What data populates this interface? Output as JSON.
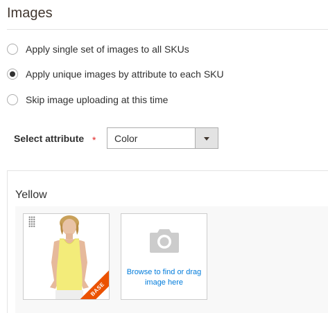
{
  "section": {
    "title": "Images"
  },
  "radios": [
    {
      "label": "Apply single set of images to all SKUs",
      "checked": false
    },
    {
      "label": "Apply unique images by attribute to each SKU",
      "checked": true
    },
    {
      "label": "Skip image uploading at this time",
      "checked": false
    }
  ],
  "attribute": {
    "label": "Select attribute",
    "required_mark": "*",
    "selected": "Color"
  },
  "group": {
    "title": "Yellow",
    "image": {
      "badge": "BASE"
    },
    "upload": {
      "text": "Browse to find or drag image here"
    }
  },
  "colors": {
    "accent": "#eb5202",
    "link": "#007bdb",
    "required": "#e22626",
    "product_top": "#f3ec7a"
  }
}
